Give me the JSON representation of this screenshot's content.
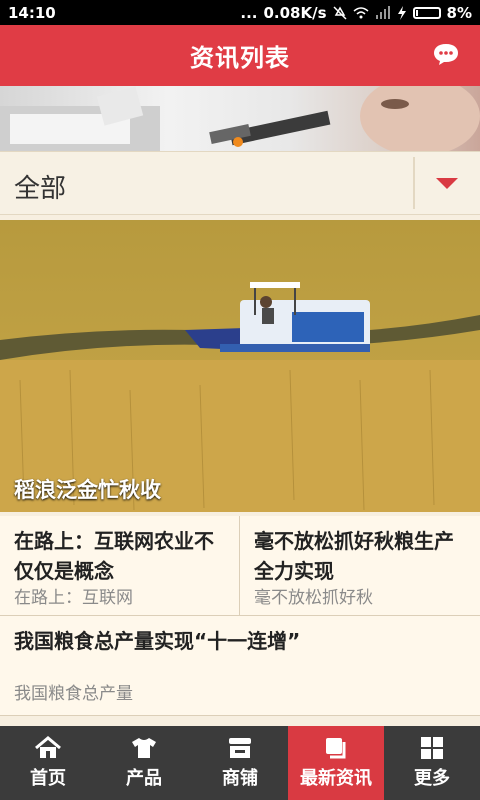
{
  "statusbar": {
    "time": "14:10",
    "signal_dots": "...",
    "network_speed": "0.08K/s",
    "battery": "8%"
  },
  "header": {
    "title": "资讯列表",
    "chat_icon": "chat-bubble-icon"
  },
  "banner": {
    "active_dot_color": "#f08a1d"
  },
  "filter": {
    "label": "全部",
    "arrow_icon": "triangle-down-icon"
  },
  "hero": {
    "caption": "稻浪泛金忙秋收"
  },
  "news": [
    {
      "title": "在路上：互联网农业不仅仅是概念",
      "subtitle": "在路上：互联网"
    },
    {
      "title": "毫不放松抓好秋粮生产 全力实现",
      "subtitle": "毫不放松抓好秋"
    },
    {
      "title": "我国粮食总产量实现“十一连增”",
      "subtitle": "我国粮食总产量"
    }
  ],
  "tabs": [
    {
      "label": "首页",
      "icon": "home-icon",
      "active": false
    },
    {
      "label": "产品",
      "icon": "shirt-icon",
      "active": false
    },
    {
      "label": "商铺",
      "icon": "shop-icon",
      "active": false
    },
    {
      "label": "最新资讯",
      "icon": "news-icon",
      "active": true
    },
    {
      "label": "更多",
      "icon": "grid-icon",
      "active": false
    }
  ],
  "colors": {
    "brand_red": "#e03c45",
    "tabbar_bg": "#3b3b3b",
    "active_tab": "#d93a42"
  }
}
